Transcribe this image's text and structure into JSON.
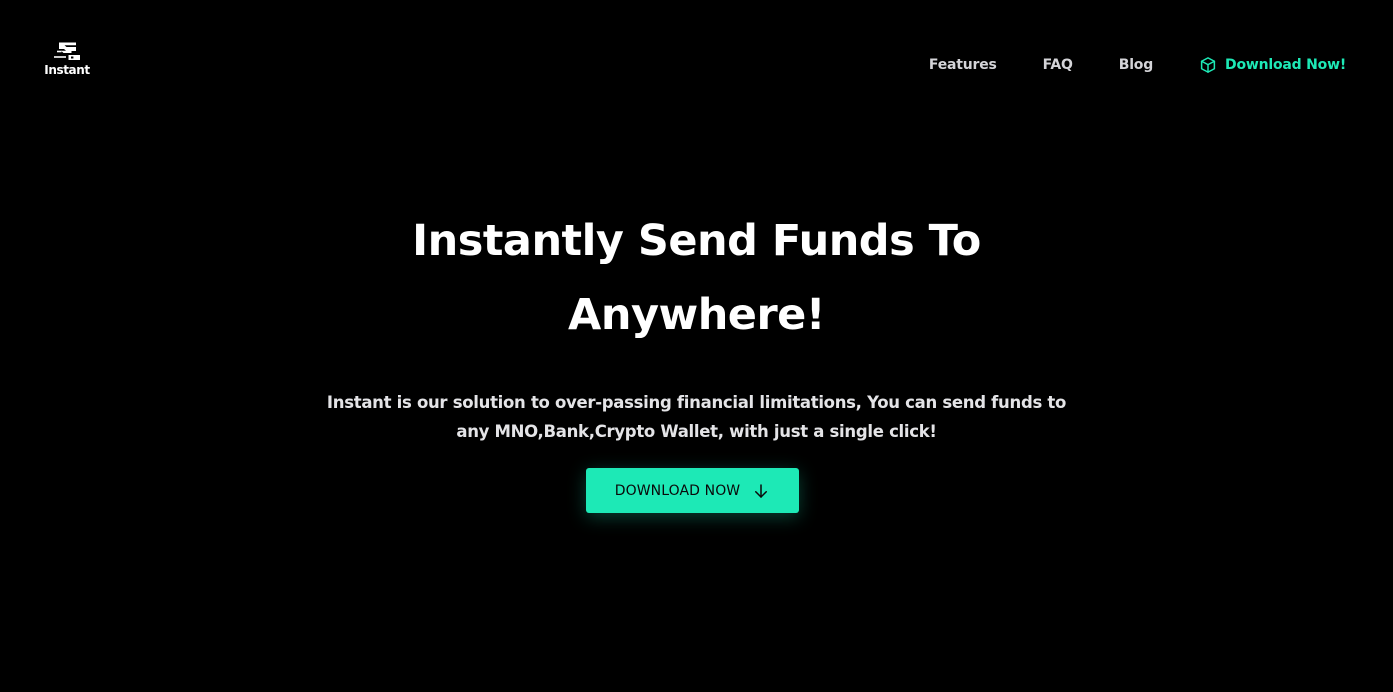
{
  "brand": {
    "name": "Instant",
    "logo_icon": "instant-logo-icon"
  },
  "nav": {
    "links": [
      {
        "label": "Features"
      },
      {
        "label": "FAQ"
      },
      {
        "label": "Blog"
      }
    ],
    "cta": {
      "label": "Download Now!",
      "icon": "cube-icon"
    }
  },
  "hero": {
    "title": "Instantly Send Funds To Anywhere!",
    "subtitle": "Instant is our solution to over-passing financial limitations, You can send funds to any MNO,Bank,Crypto Wallet, with just a single click!",
    "button": {
      "label": "DOWNLOAD NOW",
      "icon": "arrow-down-icon"
    }
  },
  "colors": {
    "background": "#000000",
    "accent": "#1de9b6",
    "text": "#ffffff",
    "nav_text": "#d4d4d8"
  }
}
